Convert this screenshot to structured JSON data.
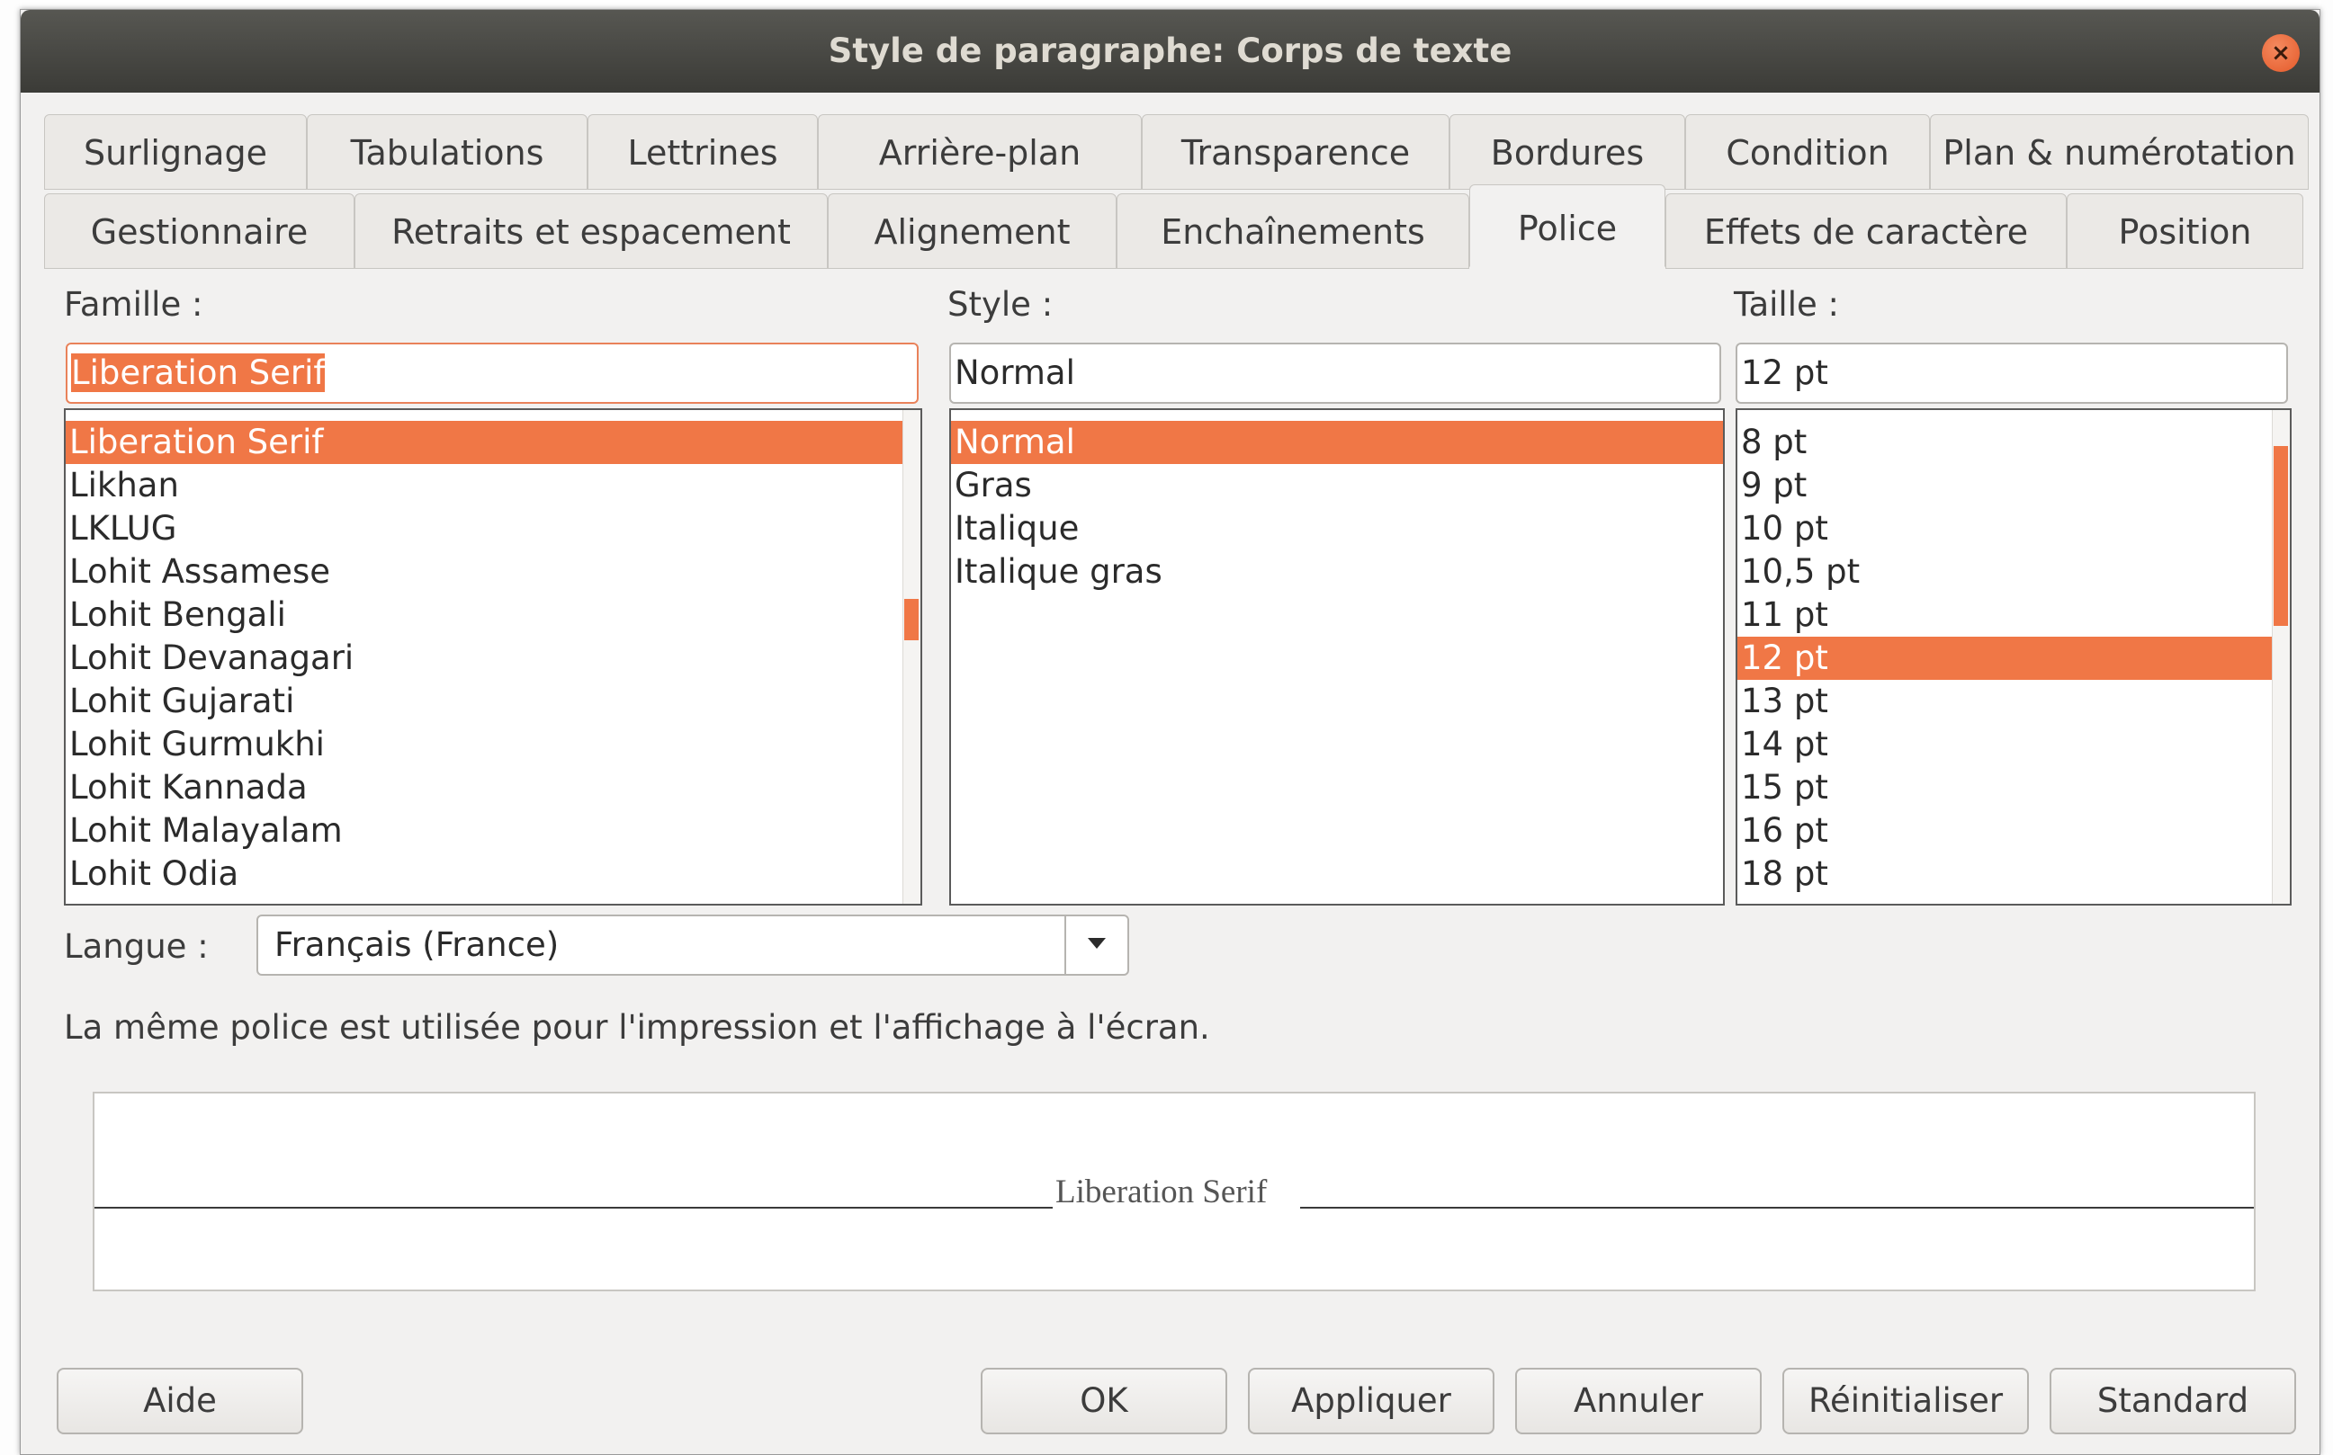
{
  "dialog": {
    "title": "Style de paragraphe: Corps de texte",
    "close_icon": "close-icon",
    "accent_color": "#f07746"
  },
  "tabs": {
    "row1": [
      "Surlignage",
      "Tabulations",
      "Lettrines",
      "Arrière-plan",
      "Transparence",
      "Bordures",
      "Condition",
      "Plan & numérotation"
    ],
    "row2": [
      "Gestionnaire",
      "Retraits et espacement",
      "Alignement",
      "Enchaînements",
      "Police",
      "Effets de caractère",
      "Position"
    ],
    "active": "Police"
  },
  "font": {
    "family_label": "Famille :",
    "family_value": "Liberation Serif",
    "family_list": [
      "Liberation Serif",
      "Likhan",
      "LKLUG",
      "Lohit Assamese",
      "Lohit Bengali",
      "Lohit Devanagari",
      "Lohit Gujarati",
      "Lohit Gurmukhi",
      "Lohit Kannada",
      "Lohit Malayalam",
      "Lohit Odia"
    ],
    "style_label": "Style :",
    "style_value": "Normal",
    "style_list": [
      "Normal",
      "Gras",
      "Italique",
      "Italique gras"
    ],
    "size_label": "Taille :",
    "size_value": "12 pt",
    "size_list": [
      "8 pt",
      "9 pt",
      "10 pt",
      "10,5 pt",
      "11 pt",
      "12 pt",
      "13 pt",
      "14 pt",
      "15 pt",
      "16 pt",
      "18 pt"
    ]
  },
  "language": {
    "label": "Langue :",
    "value": "Français (France)"
  },
  "info_text": "La même police est utilisée pour l'impression et l'affichage à l'écran.",
  "preview": {
    "sample": "Liberation Serif"
  },
  "buttons": {
    "help": "Aide",
    "ok": "OK",
    "apply": "Appliquer",
    "cancel": "Annuler",
    "reset": "Réinitialiser",
    "standard": "Standard"
  }
}
